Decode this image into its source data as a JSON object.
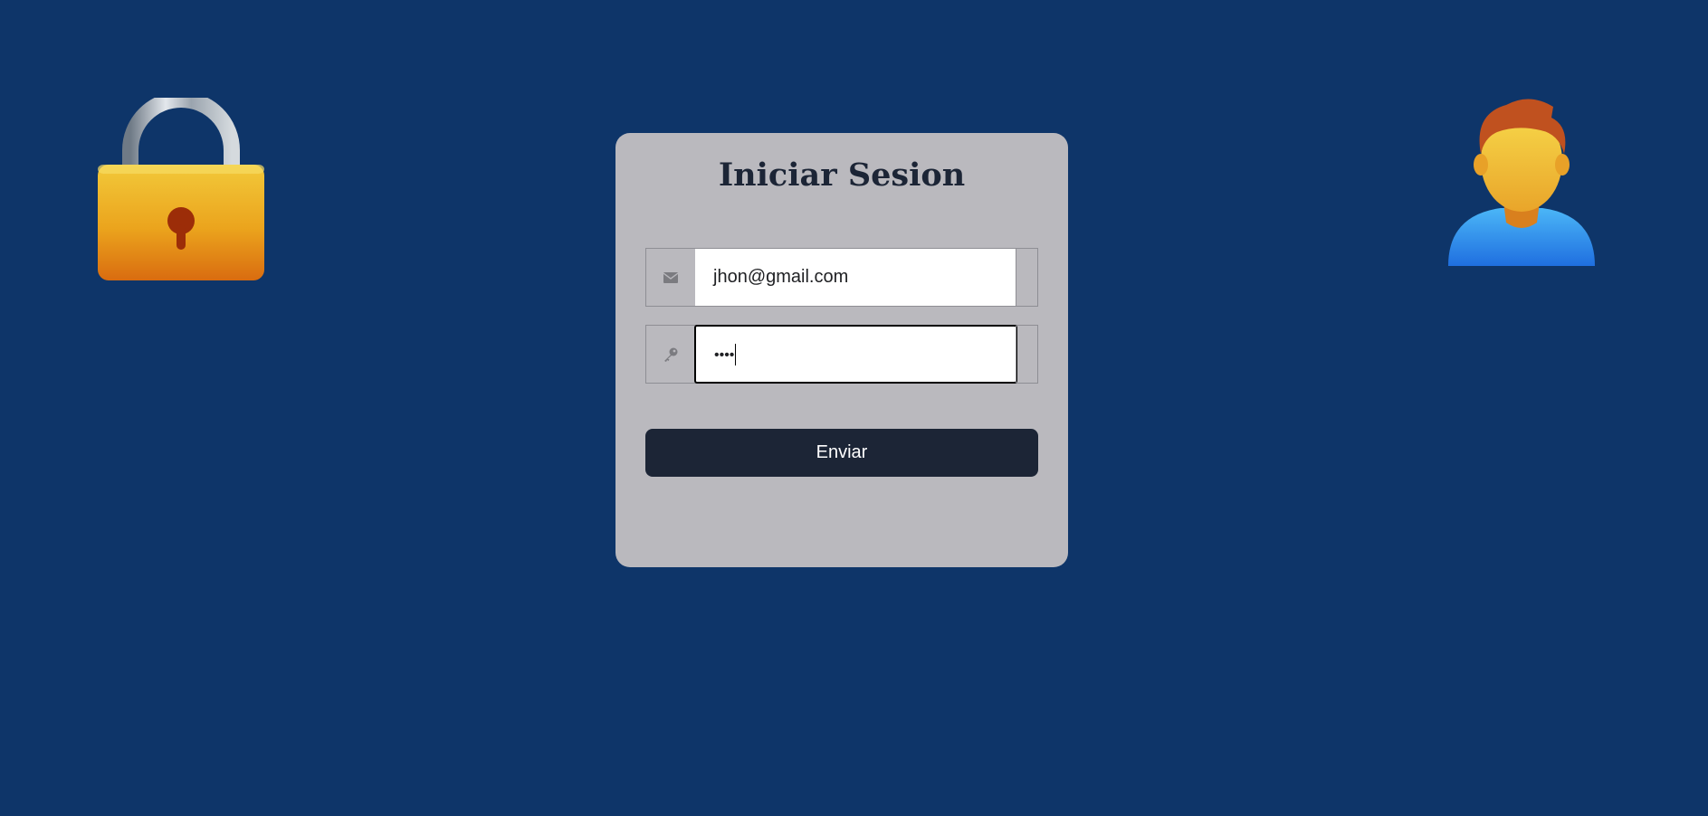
{
  "page": {
    "background_color": "#0e3569"
  },
  "decor": {
    "left_icon": "padlock-icon",
    "right_icon": "user-avatar-icon"
  },
  "login": {
    "title": "Iniciar Sesion",
    "email": {
      "icon": "envelope-icon",
      "value": "jhon@gmail.com"
    },
    "password": {
      "icon": "key-icon",
      "masked_value": "••••",
      "focused": true
    },
    "submit_label": "Enviar",
    "colors": {
      "card": "#bab9be",
      "button": "#1c2536",
      "title": "#1c2536"
    }
  }
}
